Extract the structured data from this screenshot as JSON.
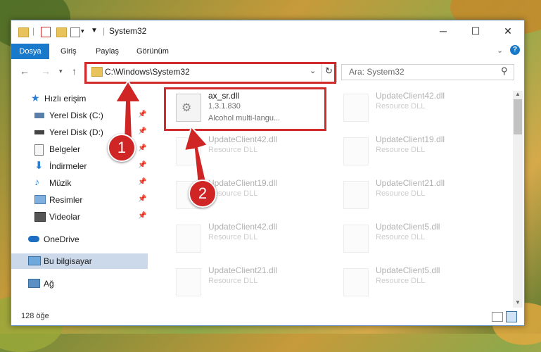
{
  "window": {
    "title": "System32",
    "controls": {
      "minimize": "─",
      "maximize": "☐",
      "close": "✕"
    }
  },
  "ribbon": {
    "tabs": [
      "Dosya",
      "Giriş",
      "Paylaş",
      "Görünüm"
    ]
  },
  "nav": {
    "address": "C:\\Windows\\System32",
    "search_placeholder": "Ara: System32"
  },
  "sidebar": {
    "items": [
      {
        "label": "Hızlı erişim",
        "icon": "star-icon"
      },
      {
        "label": "Yerel Disk (C:)",
        "icon": "drive-icon",
        "pinned": true
      },
      {
        "label": "Yerel Disk (D:)",
        "icon": "drive-icon",
        "pinned": true
      },
      {
        "label": "Belgeler",
        "icon": "documents-icon",
        "pinned": true
      },
      {
        "label": "İndirmeler",
        "icon": "download-icon",
        "pinned": true
      },
      {
        "label": "Müzik",
        "icon": "music-icon",
        "pinned": true
      },
      {
        "label": "Resimler",
        "icon": "pictures-icon",
        "pinned": true
      },
      {
        "label": "Videolar",
        "icon": "videos-icon",
        "pinned": true
      },
      {
        "label": "OneDrive",
        "icon": "cloud-icon"
      },
      {
        "label": "Bu bilgisayar",
        "icon": "computer-icon",
        "selected": true
      },
      {
        "label": "Ağ",
        "icon": "network-icon"
      }
    ]
  },
  "files": [
    {
      "name": "ax_sr.dll",
      "line2": "1.3.1.830",
      "line3": "Alcohol multi-langu...",
      "highlight": true
    },
    {
      "name": "UpdateClient42.dll",
      "line2": "Resource DLL"
    },
    {
      "name": "UpdateClient42.dll",
      "line2": "Resource DLL"
    },
    {
      "name": "UpdateClient19.dll",
      "line2": "Resource DLL"
    },
    {
      "name": "UpdateClient19.dll",
      "line2": "Resource DLL"
    },
    {
      "name": "UpdateClient21.dll",
      "line2": "Resource DLL"
    },
    {
      "name": "UpdateClient42.dll",
      "line2": "Resource DLL"
    },
    {
      "name": "UpdateClient5.dll",
      "line2": "Resource DLL"
    },
    {
      "name": "UpdateClient21.dll",
      "line2": "Resource DLL"
    },
    {
      "name": "UpdateClient5.dll",
      "line2": "Resource DLL"
    }
  ],
  "status": {
    "item_count": "128 öğe"
  },
  "annotations": {
    "step1": "1",
    "step2": "2"
  },
  "colors": {
    "accent": "#1979ca",
    "annotation_red": "#d22b2b"
  }
}
